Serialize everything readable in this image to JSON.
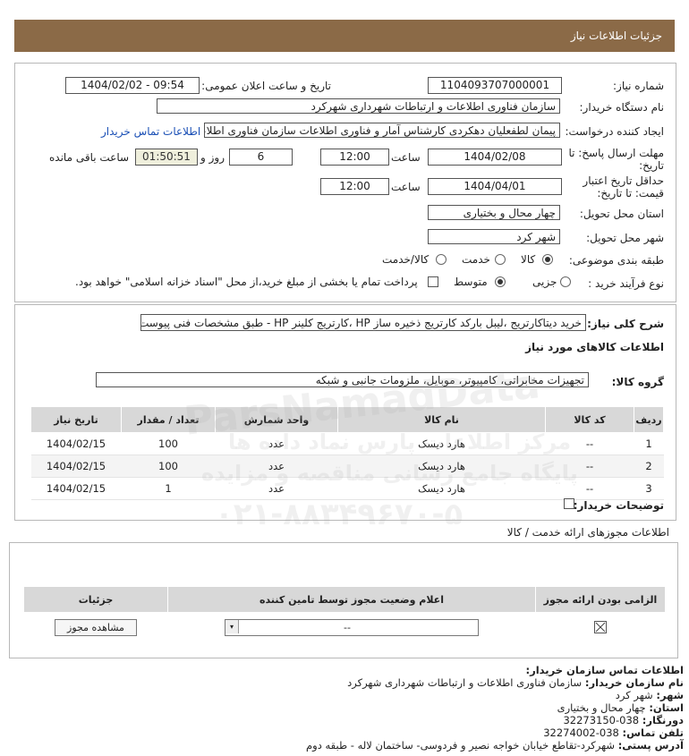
{
  "header": {
    "title": "جزئیات اطلاعات نیاز"
  },
  "need": {
    "number_label": "شماره نیاز:",
    "number_value": "1104093707000001",
    "announce_label": "تاریخ و ساعت اعلان عمومی:",
    "announce_value": "1404/02/02 - 09:54",
    "buyer_label": "نام دستگاه خریدار:",
    "buyer_value": "سازمان فناوری اطلاعات و ارتباطات شهرداری شهرکرد",
    "creator_label": "ایجاد کننده درخواست:",
    "creator_value": "پیمان لطفعلیان دهکردی کارشناس آمار و فناوری اطلاعات سازمان فناوری اطلاعا",
    "contact_link": "اطلاعات تماس خریدار",
    "deadline_label_1": "مهلت ارسال پاسخ: تا",
    "deadline_label_2": "تاریخ:",
    "deadline_date": "1404/02/08",
    "time_label": "ساعت",
    "deadline_time": "12:00",
    "days_value": "6",
    "days_label": "روز و",
    "remaining_value": "01:50:51",
    "remaining_label": "ساعت باقی مانده",
    "validity_label_1": "حداقل تاریخ اعتبار",
    "validity_label_2": "قیمت: تا تاریخ:",
    "validity_date": "1404/04/01",
    "validity_time": "12:00",
    "province_label": "استان محل تحویل:",
    "province_value": "چهار محال و بختیاری",
    "city_label": "شهر محل تحویل:",
    "city_value": "شهر کرد",
    "category_label": "طبقه بندی موضوعی:",
    "category_options": [
      "کالا",
      "خدمت",
      "کالا/خدمت"
    ],
    "process_label": "نوع فرآیند خرید :",
    "process_options": [
      "جزیی",
      "متوسط"
    ],
    "payment_text": "پرداخت تمام یا بخشی از مبلغ خرید،از محل \"اسناد خزانه اسلامی\" خواهد بود."
  },
  "description": {
    "label": "شرح کلی نیاز:",
    "value": "خرید دیتاکارتریج ،لیبل بارکد کارتریج ذخیره ساز HP ،کارتریج کلینر HP - طبق مشخصات فنی پیوست"
  },
  "goods": {
    "section_title": "اطلاعات کالاهای مورد نیاز",
    "group_label": "گروه کالا:",
    "group_value": "تجهیزات مخابراتی، کامپیوتر، موبایل، ملزومات جانبی و شبکه",
    "columns": [
      "ردیف",
      "کد کالا",
      "نام کالا",
      "واحد شمارش",
      "تعداد / مقدار",
      "تاریخ نیاز"
    ],
    "rows": [
      {
        "idx": "1",
        "code": "--",
        "name": "هارد دیسک",
        "unit": "عدد",
        "qty": "100",
        "date": "1404/02/15"
      },
      {
        "idx": "2",
        "code": "--",
        "name": "هارد دیسک",
        "unit": "عدد",
        "qty": "100",
        "date": "1404/02/15"
      },
      {
        "idx": "3",
        "code": "--",
        "name": "هارد دیسک",
        "unit": "عدد",
        "qty": "1",
        "date": "1404/02/15"
      }
    ],
    "buyer_notes_label": "توضیحات خریدار:"
  },
  "license": {
    "section_title": "اطلاعات مجوزهای ارائه خدمت / کالا",
    "columns": [
      "الزامی بودن ارائه مجوز",
      "اعلام وضعیت مجوز توسط تامین کننده",
      "جزئیات"
    ],
    "select_value": "--",
    "view_button": "مشاهده مجوز"
  },
  "contact": {
    "title": "اطلاعات تماس سازمان خریدار:",
    "org_label": "نام سازمان خریدار:",
    "org_value": "سازمان فناوری اطلاعات و ارتباطات شهرداری شهرکرد",
    "city_label": "شهر:",
    "city_value": "شهر کرد",
    "province_label": "استان:",
    "province_value": "چهار محال و بختیاری",
    "fax_label": "دورنگار:",
    "fax_value": "038-32273150",
    "phone_label": "تلفن تماس:",
    "phone_value": "038-32274002",
    "address_label": "آدرس پستی:",
    "address_value": "شهرکرد-تقاطع خیابان خواجه نصیر و فردوسی- ساختمان لاله - طبقه دوم"
  },
  "watermark": {
    "brand": "ParsNamadData",
    "line1": "مرکز اطلاعات پارس نماد داده ها",
    "line2": "پایگاه جامع رسانی مناقصه و مزایده",
    "phone": "۰۲۱-۸۸۳۴۹۶۷۰-۵"
  }
}
